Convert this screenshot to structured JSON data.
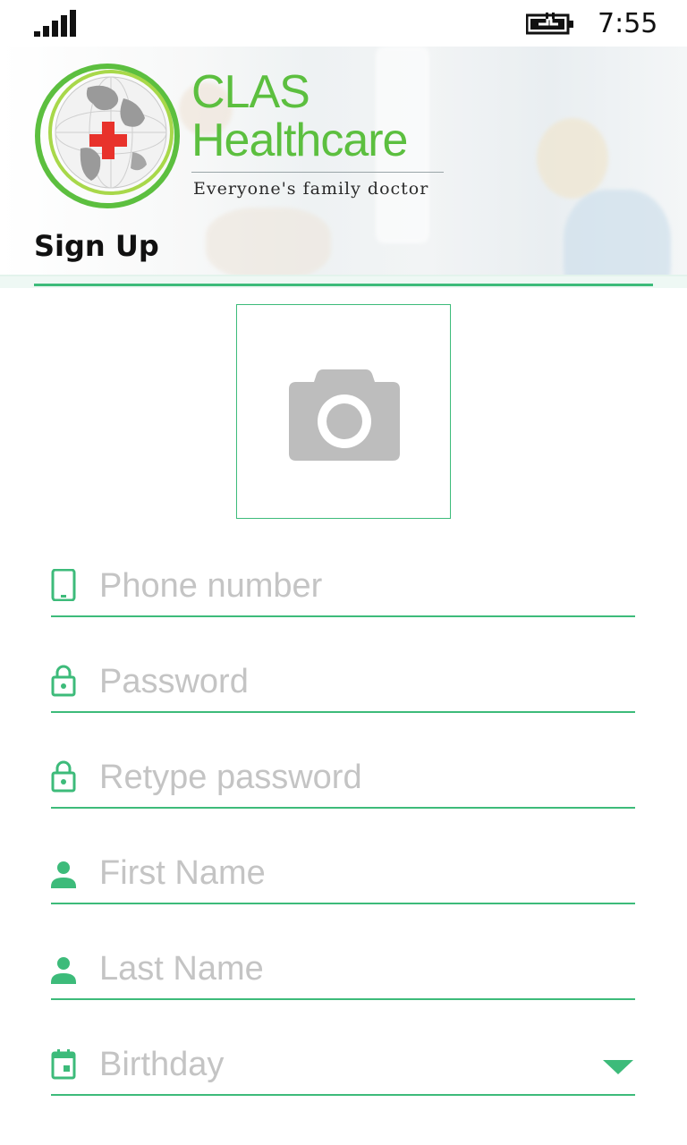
{
  "status_bar": {
    "time": "7:55",
    "signal_icon": "signal-bars-icon",
    "battery_icon": "battery-charging-icon"
  },
  "header": {
    "brand_line1": "CLAS",
    "brand_line2": "Healthcare",
    "tagline": "Everyone's family doctor",
    "logo_icon": "globe-red-cross-logo",
    "page_title": "Sign Up"
  },
  "photo": {
    "icon": "camera-icon"
  },
  "form": {
    "phone": {
      "placeholder": "Phone number",
      "icon": "smartphone-icon"
    },
    "password": {
      "placeholder": "Password",
      "icon": "lock-icon"
    },
    "retype_password": {
      "placeholder": "Retype password",
      "icon": "lock-icon"
    },
    "first_name": {
      "placeholder": "First Name",
      "icon": "person-icon"
    },
    "last_name": {
      "placeholder": "Last Name",
      "icon": "person-icon"
    },
    "birthday": {
      "placeholder": "Birthday",
      "icon": "calendar-icon",
      "dropdown_icon": "triangle-down-icon"
    }
  },
  "colors": {
    "accent": "#3dbb7a",
    "brand_green": "#5cbf3f",
    "cross_red": "#e8322b",
    "placeholder_gray": "#c4c4c4",
    "camera_gray": "#bdbdbd"
  }
}
